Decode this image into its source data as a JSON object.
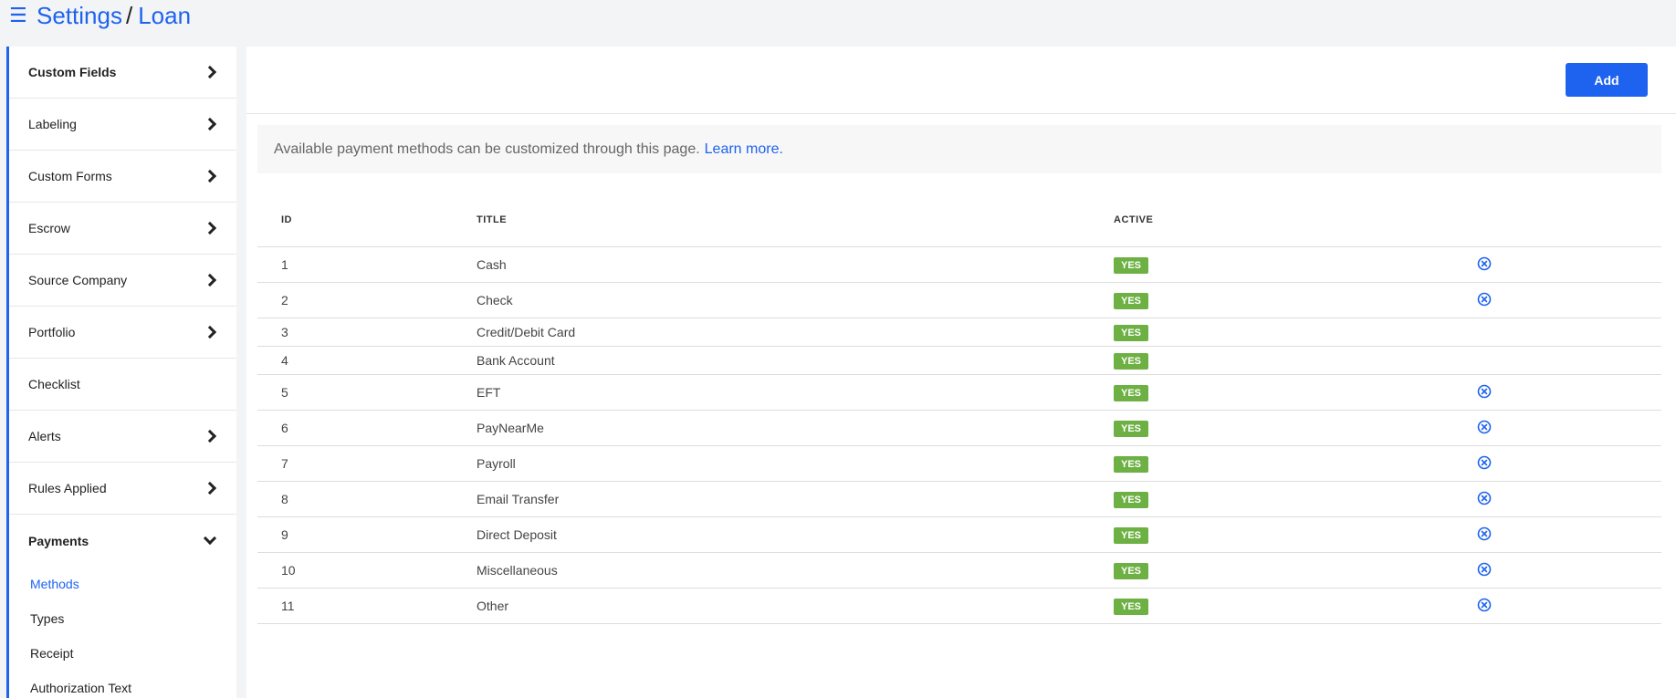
{
  "breadcrumb": {
    "parent": "Settings",
    "separator": "/",
    "current": "Loan"
  },
  "sidebar": {
    "items": [
      {
        "label": "Custom Fields",
        "chevron": "right",
        "active": true
      },
      {
        "label": "Labeling",
        "chevron": "right"
      },
      {
        "label": "Custom Forms",
        "chevron": "right"
      },
      {
        "label": "Escrow",
        "chevron": "right"
      },
      {
        "label": "Source Company",
        "chevron": "right"
      },
      {
        "label": "Portfolio",
        "chevron": "right"
      },
      {
        "label": "Checklist",
        "chevron": "none"
      },
      {
        "label": "Alerts",
        "chevron": "right"
      },
      {
        "label": "Rules Applied",
        "chevron": "right"
      },
      {
        "label": "Payments",
        "chevron": "down",
        "active": true
      }
    ],
    "subitems": [
      {
        "label": "Methods",
        "selected": true
      },
      {
        "label": "Types"
      },
      {
        "label": "Receipt"
      },
      {
        "label": "Authorization Text"
      }
    ]
  },
  "toolbar": {
    "add_label": "Add"
  },
  "info": {
    "text": "Available payment methods can be customized through this page.",
    "link": "Learn more."
  },
  "table": {
    "headers": {
      "id": "ID",
      "title": "TITLE",
      "active": "ACTIVE"
    },
    "rows": [
      {
        "id": "1",
        "title": "Cash",
        "active": "YES",
        "removable": true
      },
      {
        "id": "2",
        "title": "Check",
        "active": "YES",
        "removable": true
      },
      {
        "id": "3",
        "title": "Credit/Debit Card",
        "active": "YES",
        "removable": false
      },
      {
        "id": "4",
        "title": "Bank Account",
        "active": "YES",
        "removable": false
      },
      {
        "id": "5",
        "title": "EFT",
        "active": "YES",
        "removable": true
      },
      {
        "id": "6",
        "title": "PayNearMe",
        "active": "YES",
        "removable": true
      },
      {
        "id": "7",
        "title": "Payroll",
        "active": "YES",
        "removable": true
      },
      {
        "id": "8",
        "title": "Email Transfer",
        "active": "YES",
        "removable": true
      },
      {
        "id": "9",
        "title": "Direct Deposit",
        "active": "YES",
        "removable": true
      },
      {
        "id": "10",
        "title": "Miscellaneous",
        "active": "YES",
        "removable": true
      },
      {
        "id": "11",
        "title": "Other",
        "active": "YES",
        "removable": true
      }
    ]
  },
  "colors": {
    "accent": "#1e63f0",
    "badge": "#6db043"
  },
  "icons": {
    "menu": "hamburger-icon",
    "remove": "close-circle-icon",
    "expand": "chevron-right-icon",
    "collapse": "chevron-down-icon"
  }
}
